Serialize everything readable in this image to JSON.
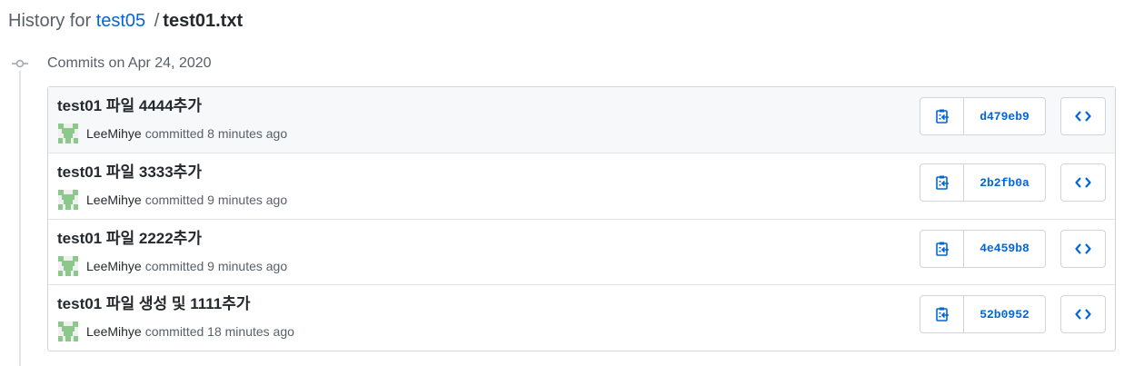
{
  "header": {
    "prefix": "History for",
    "repo": "test05",
    "separator": "/",
    "file": "test01.txt"
  },
  "timeline": {
    "date_label": "Commits on Apr 24, 2020",
    "icon": "git-commit-icon"
  },
  "commits": [
    {
      "title": "test01 파일 4444추가",
      "author": "LeeMihye",
      "action": "committed",
      "time": "8 minutes ago",
      "sha": "d479eb9"
    },
    {
      "title": "test01 파일 3333추가",
      "author": "LeeMihye",
      "action": "committed",
      "time": "9 minutes ago",
      "sha": "2b2fb0a"
    },
    {
      "title": "test01 파일 2222추가",
      "author": "LeeMihye",
      "action": "committed",
      "time": "9 minutes ago",
      "sha": "4e459b8"
    },
    {
      "title": "test01 파일 생성 및 1111추가",
      "author": "LeeMihye",
      "action": "committed",
      "time": "18 minutes ago",
      "sha": "52b0952"
    }
  ],
  "colors": {
    "link": "#0366d6",
    "avatar": "#8cc88c",
    "border": "#d1d5da"
  }
}
